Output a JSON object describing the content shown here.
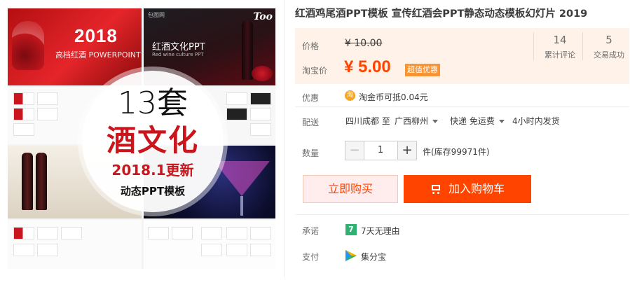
{
  "gallery": {
    "tile_red": {
      "year": "2018",
      "subtitle": "高档红酒 POWERPOINT"
    },
    "tile_dark": {
      "site": "包图网",
      "logo": "Too",
      "title": "红酒文化PPT",
      "subtitle": "Red wine culture PPT"
    },
    "badge": {
      "count": "13套",
      "main": "酒文化",
      "update": "2018.1更新",
      "sub": "动态PPT模板"
    }
  },
  "product": {
    "title": "红酒鸡尾酒PPT模板 宣传红酒会PPT静态动态模板幻灯片 2019"
  },
  "price": {
    "label_price": "价格",
    "original": "¥ 10.00",
    "label_sale": "淘宝价",
    "sale": "¥ 5.00",
    "tag": "超值优惠",
    "stats": [
      {
        "num": "14",
        "label": "累计评论"
      },
      {
        "num": "5",
        "label": "交易成功"
      }
    ]
  },
  "promo": {
    "label": "优惠",
    "icon": "淘",
    "text": "淘金币可抵0.04元"
  },
  "shipping": {
    "label": "配送",
    "from": "四川成都 至",
    "to": "广西柳州",
    "method": "快递 免运费",
    "time": "4小时内发货"
  },
  "quantity": {
    "label": "数量",
    "minus": "−",
    "value": "1",
    "plus": "+",
    "stock": "件(库存99971件)"
  },
  "actions": {
    "buy_now": "立即购买",
    "add_to_cart": "加入购物车"
  },
  "guarantee": {
    "label": "承诺",
    "icon": "7",
    "text": "7天无理由"
  },
  "payment": {
    "label": "支付",
    "text": "集分宝"
  },
  "colors": {
    "accent": "#ff4400",
    "tag_bg": "#f89433",
    "price_bg": "#fff2e8"
  }
}
